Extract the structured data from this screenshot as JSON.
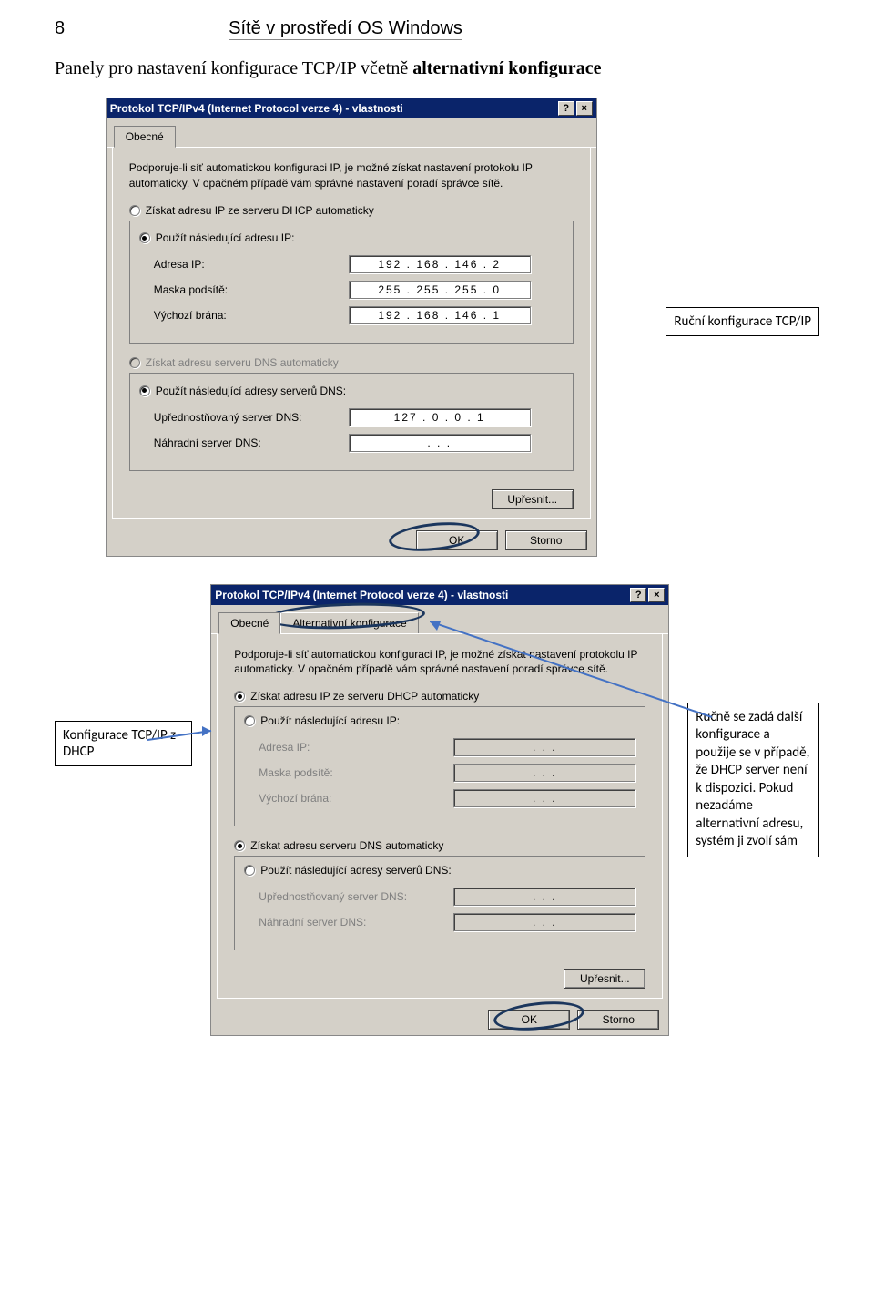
{
  "page": {
    "number": "8",
    "header": "Sítě v prostředí OS Windows",
    "intro_prefix": "Panely pro nastavení konfigurace TCP/IP včetně ",
    "intro_bold": "alternativní konfigurace"
  },
  "callouts": {
    "manual": "Ruční konfigurace TCP/IP",
    "dhcp": "Konfigurace TCP/IP z DHCP",
    "alt": "Ručně se zadá další konfigurace  a použije se v případě, že DHCP server není k dispozici. Pokud nezadáme alternativní adresu, systém ji zvolí sám"
  },
  "dialog": {
    "title": "Protokol TCP/IPv4 (Internet Protocol verze 4) - vlastnosti",
    "help": "?",
    "close": "×",
    "tabs": {
      "general": "Obecné",
      "alt": "Alternativní konfigurace"
    },
    "desc": "Podporuje-li síť automatickou konfiguraci IP, je možné získat nastavení protokolu IP automaticky. V opačném případě vám správné nastavení poradí správce sítě.",
    "radio": {
      "ip_auto": "Získat adresu IP ze serveru DHCP automaticky",
      "ip_manual": "Použít následující adresu IP:",
      "dns_auto": "Získat adresu serveru DNS automaticky",
      "dns_manual": "Použít následující adresy serverů DNS:"
    },
    "labels": {
      "ip": "Adresa IP:",
      "mask": "Maska podsítě:",
      "gw": "Výchozí brána:",
      "dns1": "Upřednostňovaný server DNS:",
      "dns2": "Náhradní server DNS:"
    },
    "values": {
      "ip": "192 . 168 . 146 .   2",
      "mask": "255 . 255 . 255 .   0",
      "gw": "192 . 168 . 146 .   1",
      "dns1": "127 .   0 .    0 .   1",
      "dns2": ".        .        .",
      "empty": ".        .        ."
    },
    "buttons": {
      "advanced": "Upřesnit...",
      "ok": "OK",
      "cancel": "Storno"
    }
  }
}
